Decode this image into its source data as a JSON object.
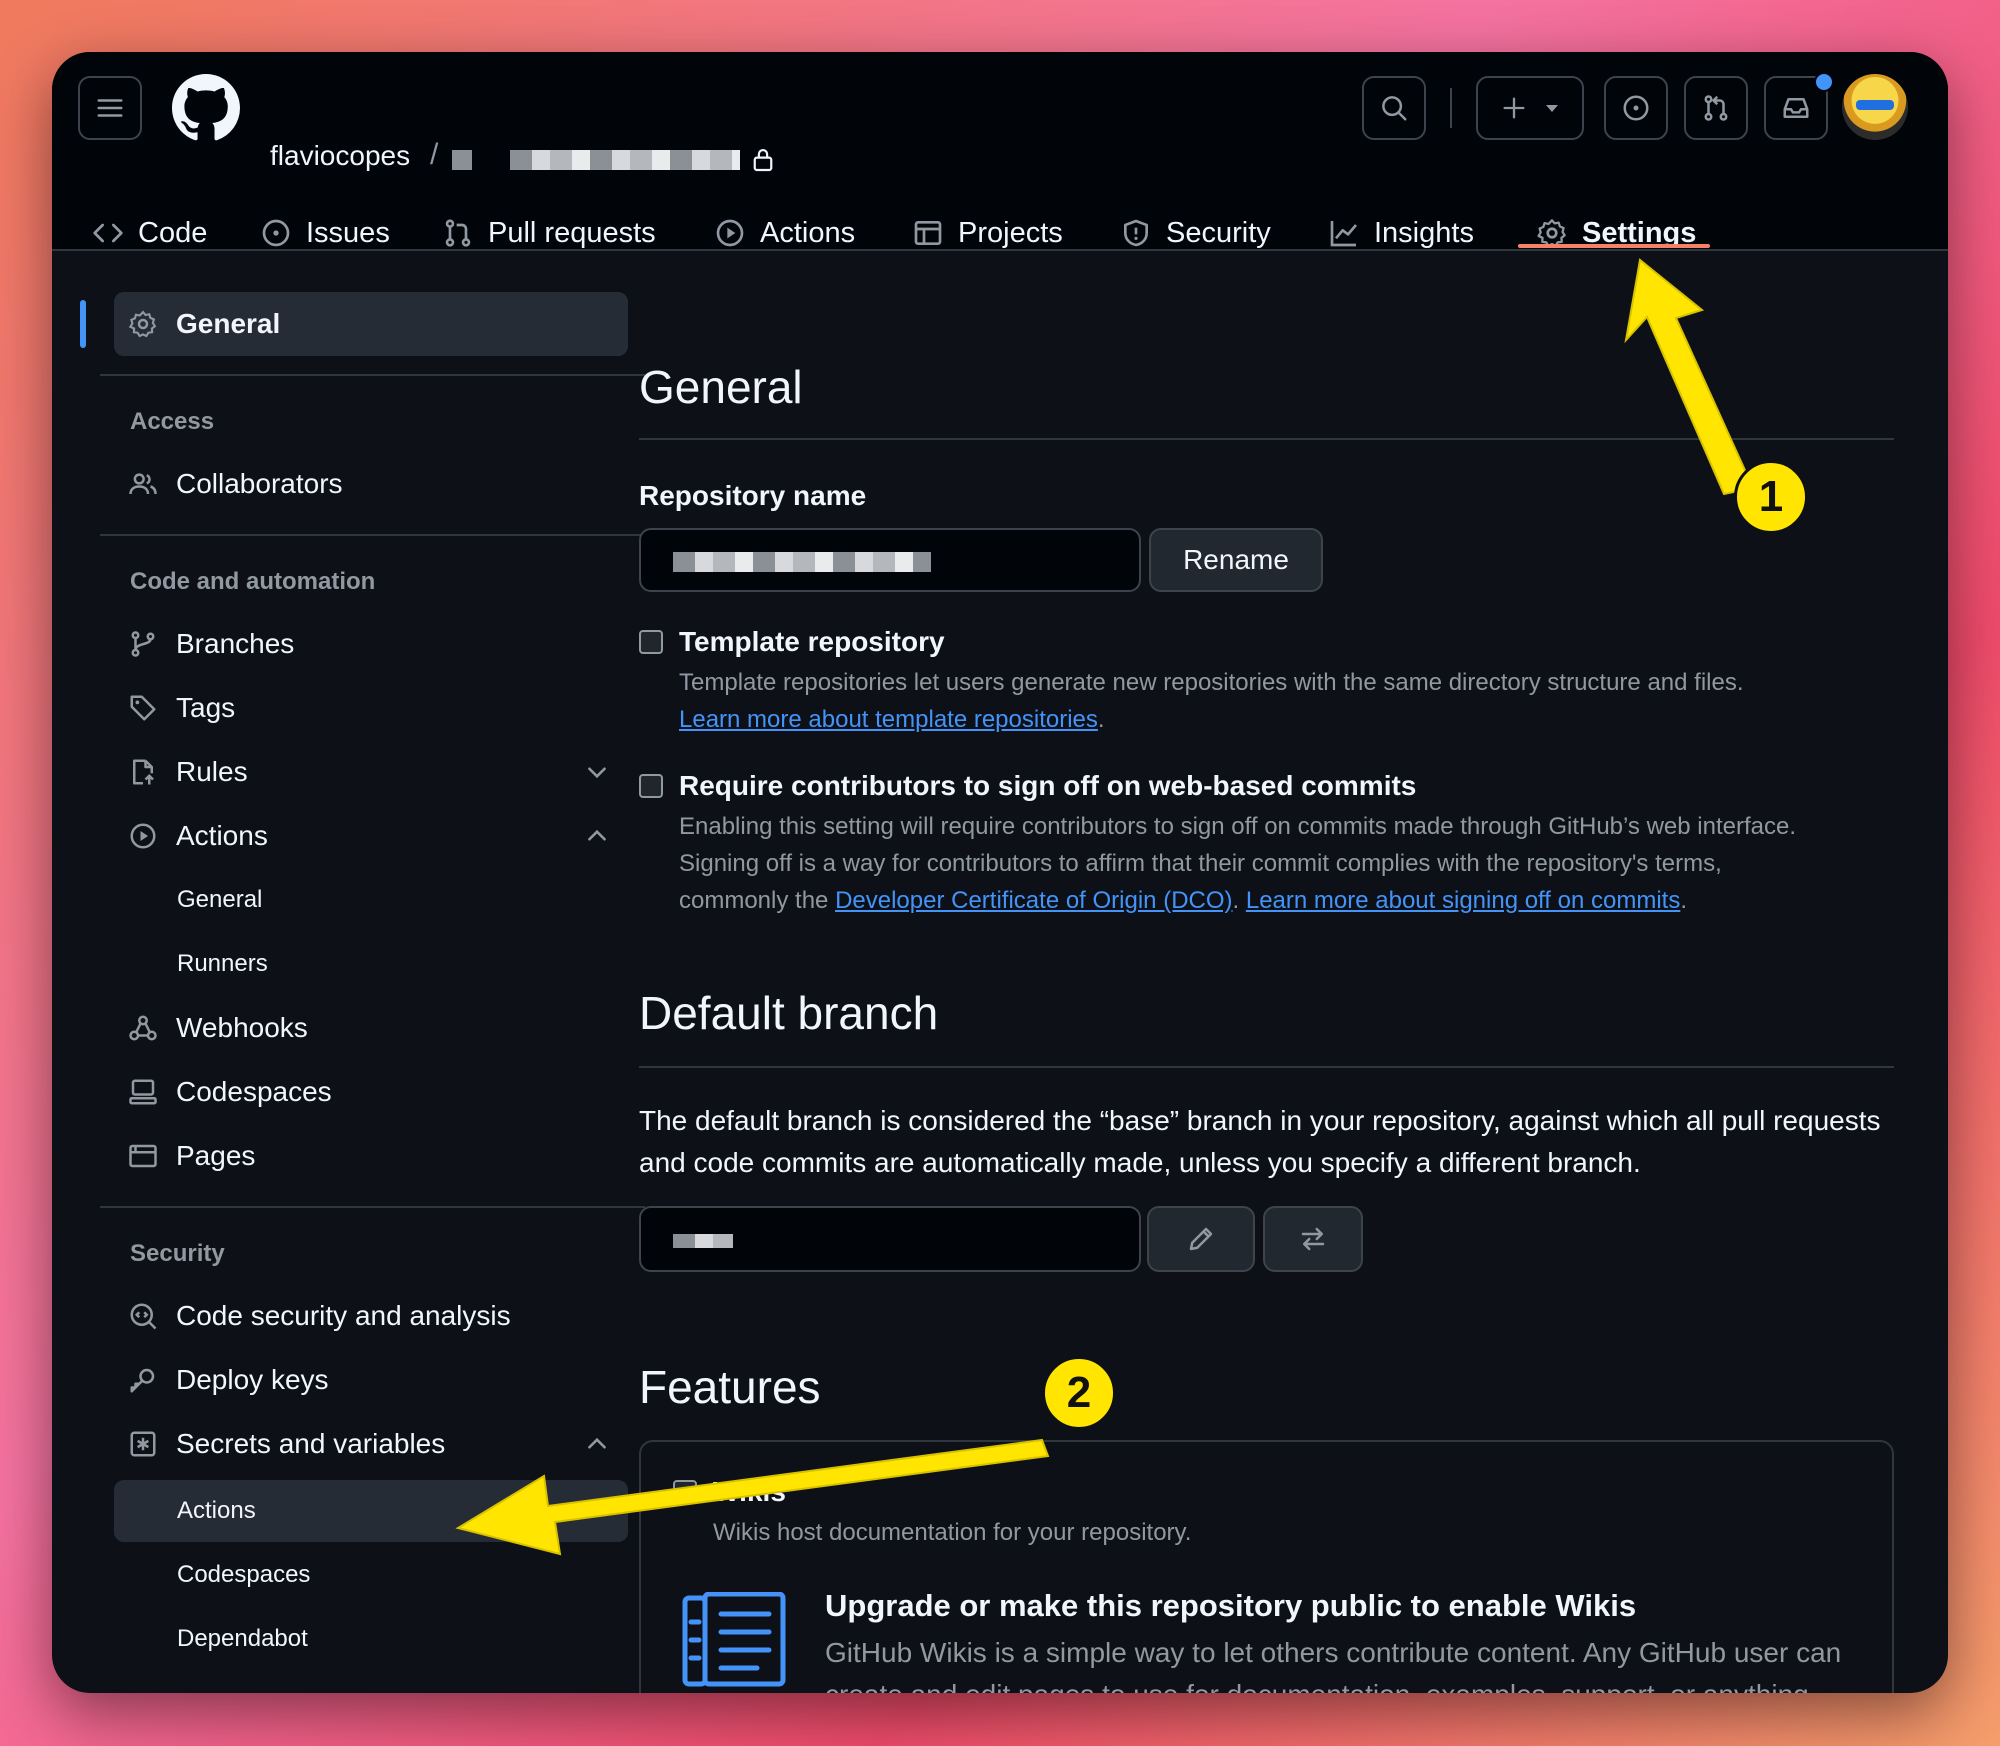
{
  "header": {
    "owner": "flaviocopes",
    "separator": "/",
    "nav_tabs": [
      {
        "label": "Code",
        "icon": "code-icon"
      },
      {
        "label": "Issues",
        "icon": "issue-icon"
      },
      {
        "label": "Pull requests",
        "icon": "pull-request-icon"
      },
      {
        "label": "Actions",
        "icon": "play-icon"
      },
      {
        "label": "Projects",
        "icon": "table-icon"
      },
      {
        "label": "Security",
        "icon": "shield-icon"
      },
      {
        "label": "Insights",
        "icon": "graph-icon"
      },
      {
        "label": "Settings",
        "icon": "gear-icon",
        "active": true
      }
    ]
  },
  "sidebar": {
    "general": "General",
    "access_heading": "Access",
    "collaborators": "Collaborators",
    "code_heading": "Code and automation",
    "branches": "Branches",
    "tags": "Tags",
    "rules": "Rules",
    "actions": "Actions",
    "actions_general": "General",
    "actions_runners": "Runners",
    "webhooks": "Webhooks",
    "codespaces": "Codespaces",
    "pages": "Pages",
    "security_heading": "Security",
    "code_security": "Code security and analysis",
    "deploy_keys": "Deploy keys",
    "secrets": "Secrets and variables",
    "secrets_actions": "Actions",
    "secrets_codespaces": "Codespaces",
    "secrets_dependabot": "Dependabot"
  },
  "main": {
    "general_title": "General",
    "repo_name_label": "Repository name",
    "rename_button": "Rename",
    "template_title": "Template repository",
    "template_desc": "Template repositories let users generate new repositories with the same directory structure and files.",
    "template_link": "Learn more about template repositories",
    "signoff_title": "Require contributors to sign off on web-based commits",
    "signoff_desc_1": "Enabling this setting will require contributors to sign off on commits made through GitHub’s web interface.",
    "signoff_desc_2": "Signing off is a way for contributors to affirm that their commit complies with the repository's terms,",
    "signoff_desc_3": "commonly the ",
    "signoff_link_1": "Developer Certificate of Origin (DCO)",
    "signoff_link_2": "Learn more about signing off on commits",
    "default_branch_title": "Default branch",
    "default_branch_desc": "The default branch is considered the “base” branch in your repository, against which all pull requests and code commits are automatically made, unless you specify a different branch.",
    "features_title": "Features",
    "wikis_title": "Wikis",
    "wikis_desc_visible": "Wikis host documentation for your repository.",
    "upgrade_title": "Upgrade or make this repository public to enable Wikis",
    "upgrade_desc": "GitHub Wikis is a simple way to let others contribute content. Any GitHub user can create and edit pages to use for documentation, examples, support, or anything you wish."
  },
  "annotations": {
    "badge_1": "1",
    "badge_2": "2"
  },
  "colors": {
    "accent": "#4493f8",
    "active_tab": "#f78166",
    "annotation": "#ffe500",
    "bg": "#0d1117"
  }
}
